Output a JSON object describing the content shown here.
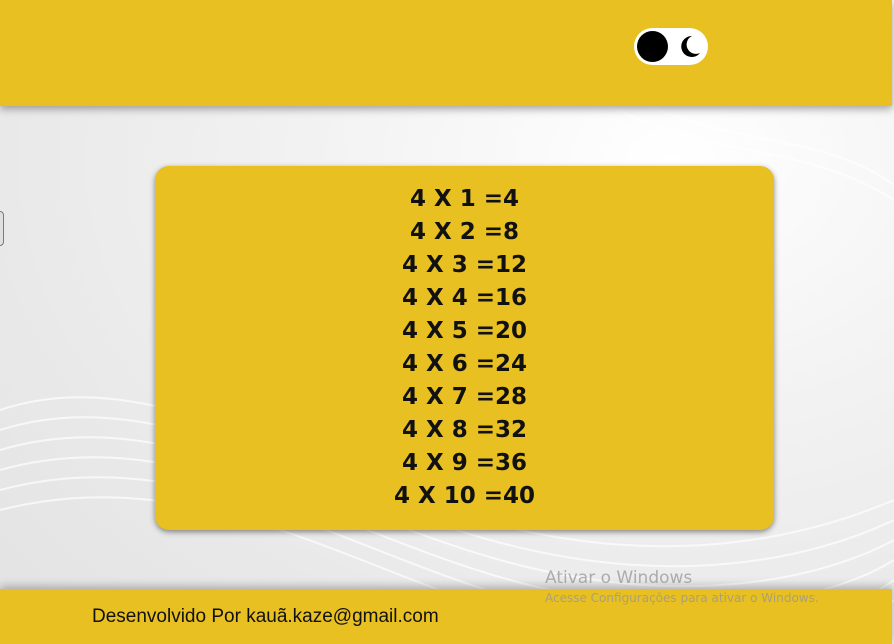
{
  "header": {
    "theme_toggle": {
      "icon": "moon-icon",
      "accent": "#e8c022",
      "knob_color": "#000000"
    }
  },
  "multiplication_table": {
    "rows": [
      "4 X 1 =4",
      "4 X 2 =8",
      "4 X 3 =12",
      "4 X 4 =16",
      "4 X 5 =20",
      "4 X 6 =24",
      "4 X 7 =28",
      "4 X 8 =32",
      "4 X 9 =36",
      "4 X 10 =40"
    ]
  },
  "footer": {
    "credit": "Desenvolvido Por kauã.kaze@gmail.com"
  },
  "windows_watermark": {
    "title": "Ativar o Windows",
    "subtitle": "Acesse Configurações para ativar o Windows."
  },
  "colors": {
    "accent_yellow": "#e8c022",
    "text_dark": "#111111"
  }
}
